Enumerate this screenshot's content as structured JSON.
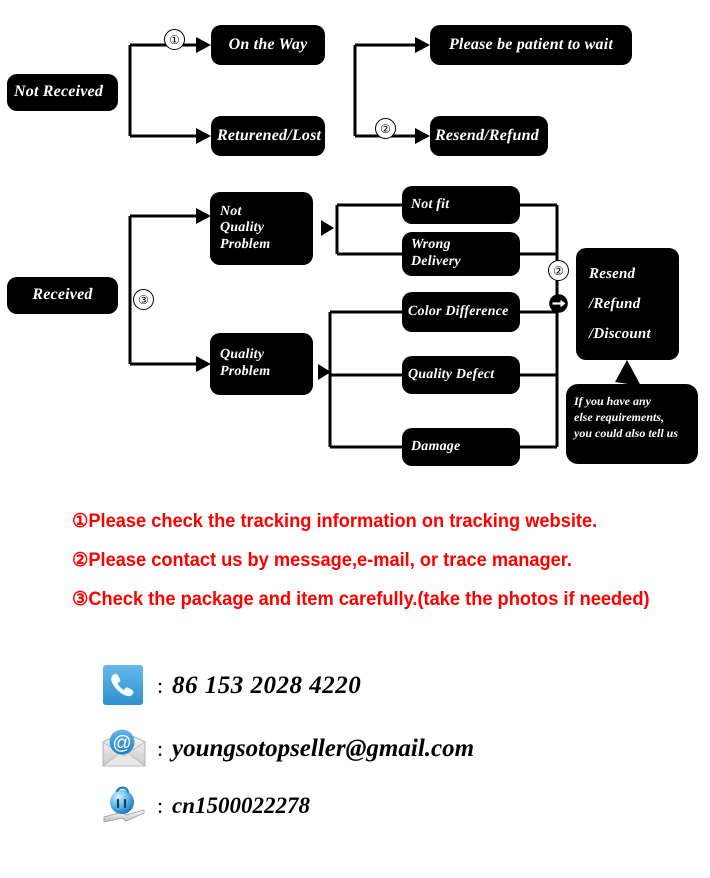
{
  "diagram": {
    "title": "Order problem handling flowchart",
    "nodes": {
      "not_received": "Not Received",
      "on_the_way": "On the Way",
      "returned_lost": "Returened/Lost",
      "please_wait": "Please be  patient to wait",
      "resend_refund": "Resend/Refund",
      "received": "Received",
      "not_quality_problem": "Not\nQuality\nProblem",
      "quality_problem": "Quality\nProblem",
      "not_fit": "Not fit",
      "wrong_delivery": "Wrong\nDelivery",
      "color_difference": "Color Difference",
      "quality_defect": "Quality Defect",
      "damage": "Damage",
      "resolution": "Resend\n/Refund\n/Discount"
    },
    "bubble": "If you have any\nelse requirements,\nyou could also tell us",
    "markers": {
      "one": "①",
      "two_top": "②",
      "two_bottom": "②",
      "three": "③"
    },
    "colors": {
      "node_fill": "#000000",
      "node_text": "#ffffff",
      "connector": "#000000",
      "note_text": "#fe0000",
      "icon_blue": "#3fa0dd"
    }
  },
  "notes": [
    "①Please check the tracking information on tracking website.",
    "②Please contact us by message,e-mail, or trace manager.",
    "③Check the package and item carefully.(take the photos if needed)"
  ],
  "contacts": [
    {
      "icon": "phone-icon",
      "separator": ":",
      "value": "86  153 2028 4220"
    },
    {
      "icon": "email-icon",
      "separator": ":",
      "value": "youngsotopseller@gmail.com"
    },
    {
      "icon": "trademanager-icon",
      "separator": ":",
      "value": "cn1500022278"
    }
  ]
}
